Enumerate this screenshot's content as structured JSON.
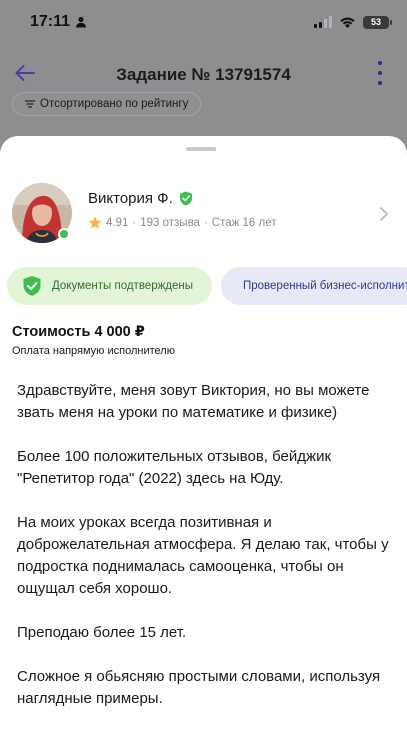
{
  "status_bar": {
    "time": "17:11",
    "battery": "53"
  },
  "header": {
    "title": "Задание № 13791574"
  },
  "sort_chip": {
    "label": "Отсортировано по рейтингу"
  },
  "profile": {
    "name": "Виктория Ф.",
    "rating": "4.91",
    "reviews": "193 отзыва",
    "experience": "Стаж 16 лет"
  },
  "badges": {
    "documents": "Документы подтверждены",
    "business": "Проверенный бизнес-исполнитель"
  },
  "offer": {
    "price": "Стоимость 4 000 ₽",
    "payment_note": "Оплата напрямую исполнителю"
  },
  "message": {
    "paragraphs": [
      "Здравствуйте, меня зовут Виктория, но вы можете звать меня на уроки по математике и физике)",
      "Более 100 положительных отзывов, бейджик \"Репетитор года\" (2022) здесь на Юду.",
      "На моих уроках всегда позитивная и доброжелательная атмосфера. Я делаю так, чтобы у подростка поднималась самооценка, чтобы он ощущал себя хорошо.",
      "Преподаю более 15 лет.",
      "Сложное я обьясняю простыми словами, используя наглядные примеры."
    ]
  },
  "colors": {
    "accent": "#5b4fc4",
    "verified_green": "#3fbd4f",
    "badge_green_bg": "#e3f5d5",
    "badge_blue_bg": "#e7e9f6"
  }
}
